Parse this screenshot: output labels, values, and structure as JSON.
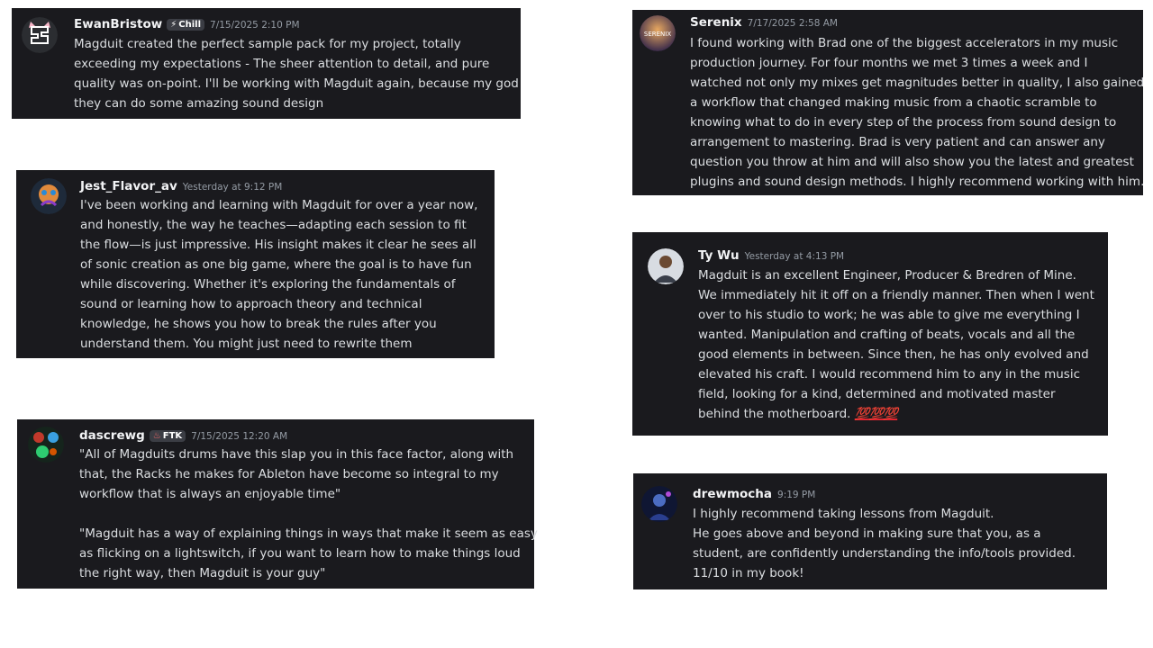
{
  "cards": [
    {
      "name": "EwanBristow",
      "tag": {
        "glyph": "⚡",
        "label": "Chill"
      },
      "timestamp": "7/15/2025 2:10 PM",
      "lines": [
        "Magduit created the perfect sample pack for my project, totally",
        "exceeding my expectations - The sheer attention to detail, and pure",
        "quality was on-point. I'll be working with Magduit again, because my god",
        "they can do some amazing sound design"
      ]
    },
    {
      "name": "Jest_Flavor_av",
      "timestamp": "Yesterday at 9:12 PM",
      "lines": [
        "I've been working and learning with Magduit for over a year now,",
        "and honestly, the way he teaches—adapting each session to fit",
        "the flow—is just impressive. His insight makes it clear he sees all",
        "of sonic creation as one big game, where the goal is to have fun",
        "while discovering. Whether it's exploring the fundamentals of",
        "sound or learning how to approach theory and technical",
        "knowledge, he shows you how to break the rules after you",
        "understand them.   You might  just need to rewrite them"
      ]
    },
    {
      "name": "dascrewg",
      "tag": {
        "glyph": "♨",
        "label": "FTK"
      },
      "timestamp": "7/15/2025 12:20 AM",
      "lines": [
        "\"All of Magduits drums have this slap you in this face factor, along with",
        "that, the Racks he makes for Ableton have become so integral to my",
        "workflow that is always an enjoyable time\"",
        "",
        "\"Magduit has a way of explaining things in ways that make it seem as easy",
        "as flicking on a lightswitch, if you want to learn how to make things loud",
        "the right way, then Magduit is your guy\""
      ]
    },
    {
      "name": "Serenix",
      "timestamp": "7/17/2025 2:58 AM",
      "avatar_text": "SERENIX",
      "lines": [
        "I found working with Brad one of the biggest accelerators in my music",
        "production journey. For four months we met 3 times a week and I",
        "watched not only my mixes get magnitudes better in quality, I also gained",
        "a workflow that changed making music from a chaotic scramble to",
        "knowing what to do in every step of the process from sound design to",
        "arrangement to mastering. Brad is very patient and can answer any",
        "question you throw at him and will also show you the latest and greatest",
        "plugins and sound design methods. I highly recommend working with him."
      ]
    },
    {
      "name": "Ty Wu",
      "timestamp": "Yesterday at 4:13 PM",
      "lines": [
        "Magduit is an excellent Engineer, Producer & Bredren of Mine.",
        "We immediately hit it off on a friendly manner. Then when I went",
        "over to his studio to work; he was able to give me everything I",
        "wanted. Manipulation and crafting of beats, vocals and all the",
        "good elements in between. Since then, he has only evolved and",
        "elevated his craft. I would recommend him to any in the music",
        "field, looking for a kind, determined and motivated master",
        "behind the motherboard."
      ],
      "emoji": "💯💯💯"
    },
    {
      "name": "drewmocha",
      "timestamp": "9:19 PM",
      "lines": [
        "I highly recommend taking lessons from Magduit.",
        "He goes above and beyond in making sure that you, as a",
        "student, are confidently understanding the info/tools provided.",
        "11/10 in my book!"
      ]
    }
  ]
}
